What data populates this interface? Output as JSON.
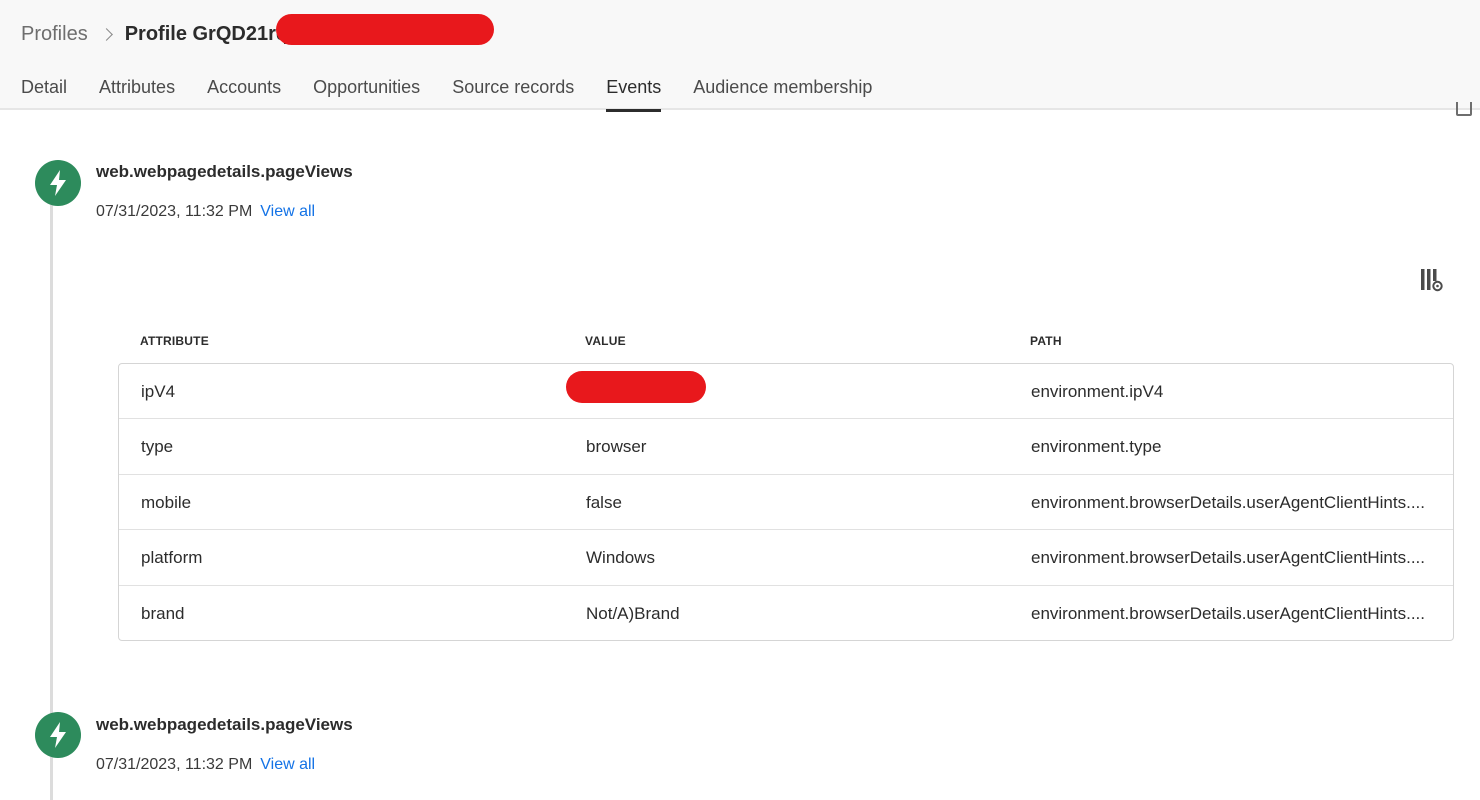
{
  "breadcrumb": {
    "root": "Profiles",
    "current": "Profile GrQD21rqz"
  },
  "tabs": [
    {
      "label": "Detail",
      "active": false
    },
    {
      "label": "Attributes",
      "active": false
    },
    {
      "label": "Accounts",
      "active": false
    },
    {
      "label": "Opportunities",
      "active": false
    },
    {
      "label": "Source records",
      "active": false
    },
    {
      "label": "Events",
      "active": true
    },
    {
      "label": "Audience membership",
      "active": false
    }
  ],
  "events": [
    {
      "icon": "lightning-icon",
      "title": "web.webpagedetails.pageViews",
      "timestamp": "07/31/2023, 11:32 PM",
      "link": "View all",
      "table": {
        "headers": [
          "ATTRIBUTE",
          "VALUE",
          "PATH"
        ],
        "rows": [
          {
            "attribute": "ipV4",
            "value": "",
            "path": "environment.ipV4"
          },
          {
            "attribute": "type",
            "value": "browser",
            "path": "environment.type"
          },
          {
            "attribute": "mobile",
            "value": "false",
            "path": "environment.browserDetails.userAgentClientHints...."
          },
          {
            "attribute": "platform",
            "value": "Windows",
            "path": "environment.browserDetails.userAgentClientHints...."
          },
          {
            "attribute": "brand",
            "value": "Not/A)Brand",
            "path": "environment.browserDetails.userAgentClientHints...."
          }
        ]
      }
    },
    {
      "icon": "lightning-icon",
      "title": "web.webpagedetails.pageViews",
      "timestamp": "07/31/2023, 11:32 PM",
      "link": "View all"
    }
  ],
  "colors": {
    "event_icon": "#2d8b5c",
    "link": "#1473e6",
    "redaction": "#e8181c"
  }
}
